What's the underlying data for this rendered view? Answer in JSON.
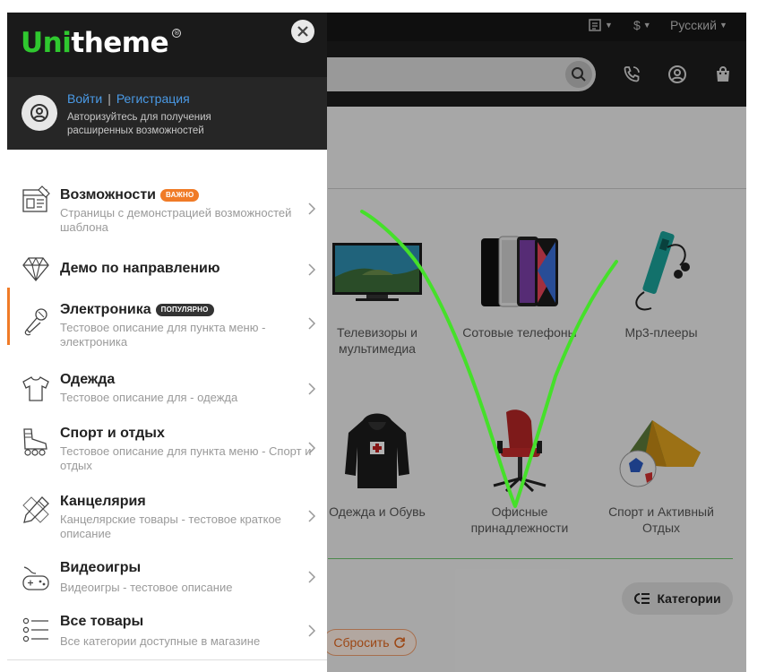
{
  "topbar": {
    "currency": "$",
    "language": "Русский"
  },
  "drawer": {
    "logo_uni": "Uni",
    "logo_theme": "theme",
    "logo_mark": "®",
    "login": "Войти",
    "separator": "|",
    "register": "Регистрация",
    "auth_note": "Авторизуйтесь для получения расширенных возможностей",
    "menu": [
      {
        "title": "Возможности",
        "badge": "ВАЖНО",
        "desc": "Страницы с демонстрацией возможностей шаблона",
        "icon": "layout-icon"
      },
      {
        "title": "Демо по направлению",
        "badge": "",
        "desc": "",
        "icon": "diamond-icon"
      },
      {
        "title": "Электроника",
        "badge": "ПОПУЛЯРНО",
        "desc": "Тестовое описание для пункта меню - электроника",
        "icon": "microphone-icon"
      },
      {
        "title": "Одежда",
        "badge": "",
        "desc": "Тестовое описание для - одежда",
        "icon": "tshirt-icon"
      },
      {
        "title": "Спорт и отдых",
        "badge": "",
        "desc": "Тестовое описание для пункта меню - Спорт и отдых",
        "icon": "rollerskate-icon"
      },
      {
        "title": "Канцелярия",
        "badge": "",
        "desc": "Канцелярские товары - тестовое краткое описание",
        "icon": "pencil-ruler-icon"
      },
      {
        "title": "Видеоигры",
        "badge": "",
        "desc": "Видеоигры - тестовое описание",
        "icon": "gamepad-icon"
      },
      {
        "title": "Все товары",
        "badge": "",
        "desc": "Все категории доступные в магазине",
        "icon": "list-icon"
      }
    ]
  },
  "categories": [
    {
      "label": "Телевизоры и мультимедиа",
      "icon": "tv-icon"
    },
    {
      "label": "Сотовые телефоны",
      "icon": "phones-icon"
    },
    {
      "label": "Mp3-плееры",
      "icon": "mp3-player-icon"
    },
    {
      "label": "Одежда и Обувь",
      "icon": "hoodie-icon"
    },
    {
      "label": "Офисные принадлежности",
      "icon": "office-chair-icon"
    },
    {
      "label": "Спорт и Активный Отдых",
      "icon": "tent-icon"
    }
  ],
  "buttons": {
    "categories": "Категории",
    "reset": "Сбросить"
  },
  "colors": {
    "accent_green": "#2fc82f",
    "accent_orange": "#f07b27",
    "badge_dark": "#333333",
    "link_blue": "#4a9ae6"
  }
}
